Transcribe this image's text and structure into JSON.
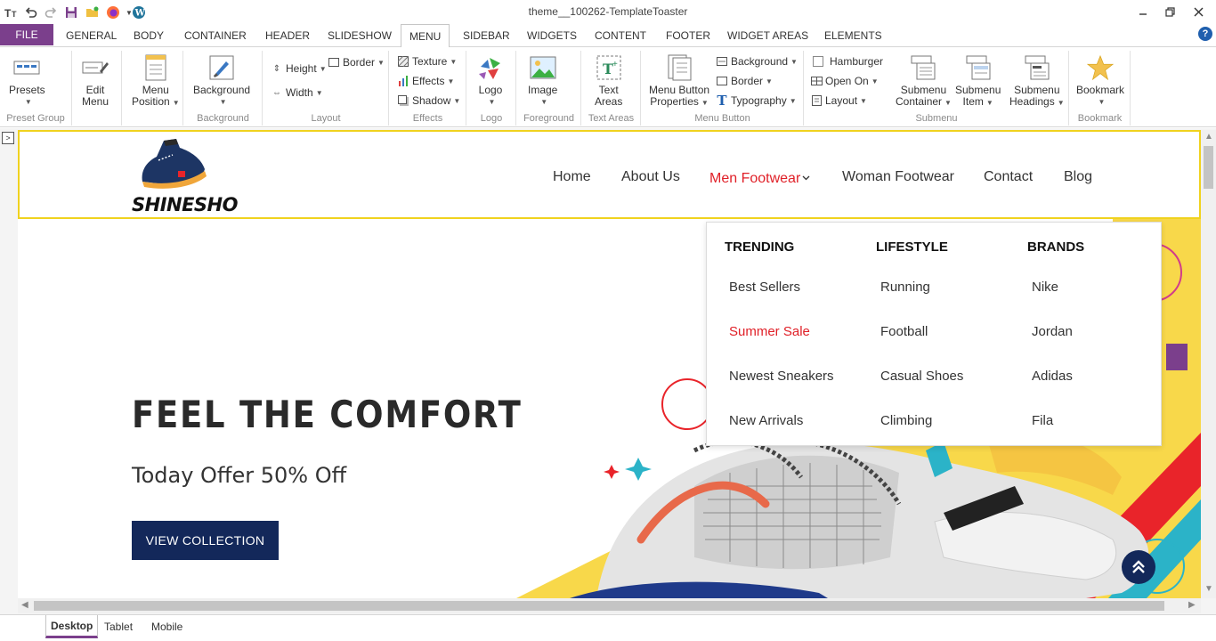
{
  "window": {
    "title": "theme__100262-TemplateToaster"
  },
  "ribbon": {
    "file_label": "FILE",
    "tabs": [
      {
        "label": "GENERAL"
      },
      {
        "label": "BODY"
      },
      {
        "label": "CONTAINER"
      },
      {
        "label": "HEADER"
      },
      {
        "label": "SLIDESHOW"
      },
      {
        "label": "MENU",
        "active": true
      },
      {
        "label": "SIDEBAR"
      },
      {
        "label": "WIDGETS"
      },
      {
        "label": "CONTENT"
      },
      {
        "label": "FOOTER"
      },
      {
        "label": "WIDGET AREAS"
      },
      {
        "label": "ELEMENTS"
      }
    ],
    "help": "?",
    "groups": {
      "preset_group": {
        "label": "Preset Group",
        "presets": "Presets"
      },
      "edit_menu": {
        "label_line1": "Edit",
        "label_line2": "Menu"
      },
      "menu_position": {
        "label_line1": "Menu",
        "label_line2": "Position"
      },
      "background": {
        "label": "Background",
        "button": "Background"
      },
      "layout": {
        "label": "Layout",
        "height": "Height",
        "width": "Width",
        "border": "Border"
      },
      "effects": {
        "label": "Effects",
        "texture": "Texture",
        "effects": "Effects",
        "shadow": "Shadow"
      },
      "logo": {
        "label": "Logo",
        "button": "Logo"
      },
      "foreground": {
        "label": "Foreground",
        "button": "Image"
      },
      "text_areas": {
        "label": "Text Areas",
        "line1": "Text",
        "line2": "Areas"
      },
      "menu_button": {
        "label": "Menu Button",
        "props_line1": "Menu Button",
        "props_line2": "Properties",
        "background": "Background",
        "border": "Border",
        "typography": "Typography"
      },
      "submenu": {
        "label": "Submenu",
        "hamburger": "Hamburger",
        "open_on": "Open On",
        "layout": "Layout",
        "container_line1": "Submenu",
        "container_line2": "Container",
        "item_line1": "Submenu",
        "item_line2": "Item",
        "headings_line1": "Submenu",
        "headings_line2": "Headings"
      },
      "bookmark": {
        "label": "Bookmark",
        "button": "Bookmark"
      }
    }
  },
  "site": {
    "logo_text": "SHINESHO",
    "nav": [
      {
        "label": "Home"
      },
      {
        "label": "About Us"
      },
      {
        "label": "Men Footwear",
        "active": true
      },
      {
        "label": "Woman Footwear"
      },
      {
        "label": "Contact"
      },
      {
        "label": "Blog"
      }
    ],
    "mega_menu": {
      "columns": [
        {
          "heading": "TRENDING",
          "items": [
            "Best Sellers",
            "Summer Sale",
            "Newest Sneakers",
            "New Arrivals"
          ]
        },
        {
          "heading": "LIFESTYLE",
          "items": [
            "Running",
            "Football",
            "Casual Shoes",
            "Climbing"
          ]
        },
        {
          "heading": "BRANDS",
          "items": [
            "Nike",
            "Jordan",
            "Adidas",
            "Fila"
          ]
        }
      ],
      "highlighted_item": "Summer Sale"
    },
    "hero": {
      "title": "FEEL THE COMFORT",
      "subtitle": "Today Offer 50% Off",
      "button": "VIEW COLLECTION"
    }
  },
  "view_tabs": [
    {
      "label": "Desktop",
      "active": true
    },
    {
      "label": "Tablet"
    },
    {
      "label": "Mobile"
    }
  ],
  "colors": {
    "brand_purple": "#7b3f8c",
    "menu_active_red": "#e02028",
    "navy": "#13285a",
    "header_border_yellow": "#f0d21e",
    "hero_yellow": "#f8d84a"
  }
}
